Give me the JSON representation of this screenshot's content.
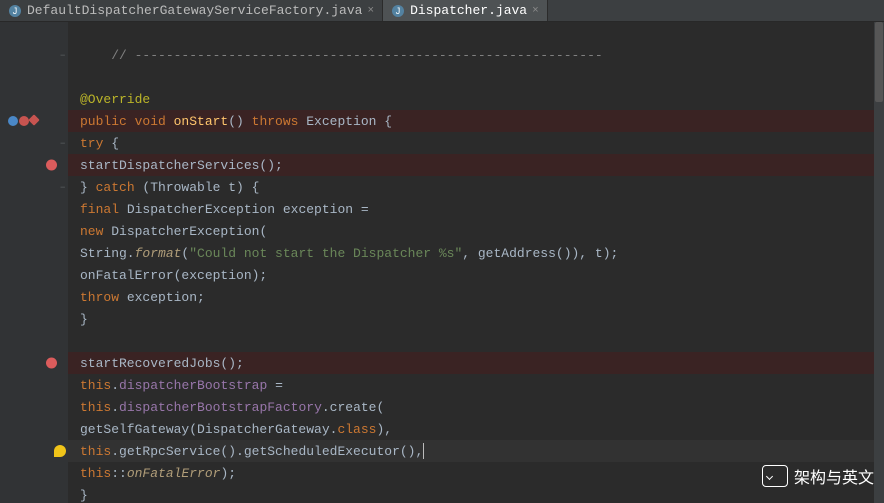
{
  "tabs": [
    {
      "label": "DefaultDispatcherGatewayServiceFactory.java",
      "active": false
    },
    {
      "label": "Dispatcher.java",
      "active": true
    }
  ],
  "code": {
    "l2": "// ------------------------------------------------------------",
    "l4": "@Override",
    "l5_public": "public ",
    "l5_void": "void ",
    "l5_fn": "onStart",
    "l5_rest": "() ",
    "l5_throws": "throws ",
    "l5_ex": "Exception {",
    "l6_try": "try ",
    "l6_brace": "{",
    "l7_call": "startDispatcherServices();",
    "l8_a": "} ",
    "l8_catch": "catch ",
    "l8_b": "(Throwable t) {",
    "l9_final": "final ",
    "l9_type": "DispatcherException exception =",
    "l10_new": "new ",
    "l10_rest": "DispatcherException(",
    "l11_a": "String.",
    "l11_fmt": "format",
    "l11_b": "(",
    "l11_str": "\"Could not start the Dispatcher %s\"",
    "l11_c": ", getAddress()), t);",
    "l12": "onFatalError(exception);",
    "l13_throw": "throw ",
    "l13_rest": "exception;",
    "l14": "}",
    "l16": "startRecoveredJobs();",
    "l17_this": "this",
    "l17_dot": ".",
    "l17_fld": "dispatcherBootstrap",
    "l17_eq": " =",
    "l18_this": "this",
    "l18_dot": ".",
    "l18_fld": "dispatcherBootstrapFactory",
    "l18_rest": ".create(",
    "l19_a": "getSelfGateway(DispatcherGateway.",
    "l19_cls": "class",
    "l19_b": "),",
    "l20_this": "this",
    "l20_rest": ".getRpcService().getScheduledExecutor(),",
    "l21_this": "this",
    "l21_cc": "::",
    "l21_fn": "onFatalError",
    "l21_end": ");",
    "l22": "}"
  },
  "watermark": "架构与英文",
  "icons": {
    "java": "J",
    "close": "×"
  }
}
